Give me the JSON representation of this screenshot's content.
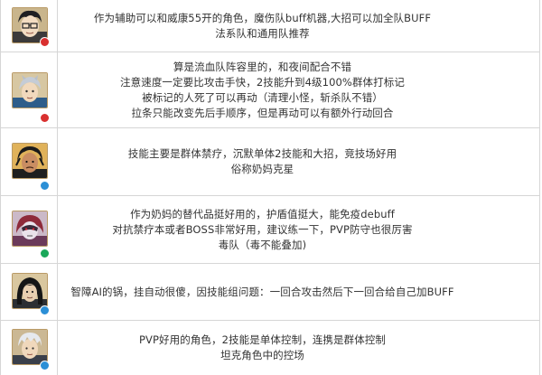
{
  "rows": [
    {
      "character_icon": "character-portrait-glasses-boy",
      "badge_color": "#d9302f",
      "lines": [
        "作为辅助可以和威康55开的角色，魔伤队buff机器,大招可以加全队BUFF",
        "法系队和通用队推荐"
      ]
    },
    {
      "character_icon": "character-portrait-silver-hair",
      "badge_color": "#d9302f",
      "lines": [
        "算是流血队阵容里的，和夜间配合不错",
        "注意速度一定要比攻击手快，2技能升到4级100%群体打标记",
        "被标记的人死了可以再动（清理小怪，斩杀队不错）",
        "拉条只能改变先后手顺序，但是再动可以有额外行动回合"
      ]
    },
    {
      "character_icon": "character-portrait-dark-hair",
      "badge_color": "#2b8fd6",
      "lines": [
        "技能主要是群体禁疗，沉默单体2技能和大招，竞技场好用",
        "俗称奶妈克星"
      ]
    },
    {
      "character_icon": "character-portrait-mask",
      "badge_color": "#1aa85a",
      "lines": [
        "作为奶妈的替代品挺好用的，护盾值挺大，能免疫debuff",
        "对抗禁疗本或者BOSS非常好用，建议练一下，PVP防守也很厉害",
        "毒队（毒不能叠加)"
      ]
    },
    {
      "character_icon": "character-portrait-long-hair",
      "badge_color": "#2b8fd6",
      "lines": [
        "智障AI的锅，挂自动很傻，因技能组问题：一回合攻击然后下一回合给自己加BUFF"
      ]
    },
    {
      "character_icon": "character-portrait-white-hair",
      "badge_color": "#2b8fd6",
      "lines": [
        "PVP好用的角色，2技能是单体控制，连携是群体控制",
        "坦克角色中的控场"
      ]
    }
  ]
}
